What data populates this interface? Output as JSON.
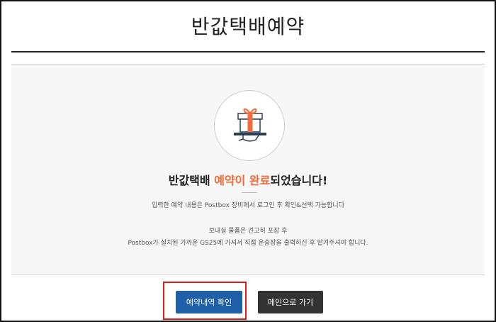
{
  "header": {
    "title": "반값택배예약"
  },
  "completion": {
    "title_prefix": "반값택배 ",
    "title_accent": "예약이 완료",
    "title_suffix": "되었습니다!",
    "info_line1": "입력한 예약 내용은 Postbox 장비에서 로그인 후 확인&선택 가능합니다",
    "info_line2": "보내실 물품은 견고히 포장 후",
    "info_line3": "Postbox가 설치된 가까운 GS25에 가셔서 직접 운송장을 출력하신 후 맡겨주셔야 합니다."
  },
  "actions": {
    "check_reservation_label": "예약내역 확인",
    "go_main_label": "메인으로 가기"
  },
  "colors": {
    "accent": "#f26b3a",
    "primary_button": "#1f5fa8",
    "secondary_button": "#333333",
    "highlight": "#e41a1a"
  },
  "icons": {
    "completion_icon": "gift-on-hand-icon"
  }
}
